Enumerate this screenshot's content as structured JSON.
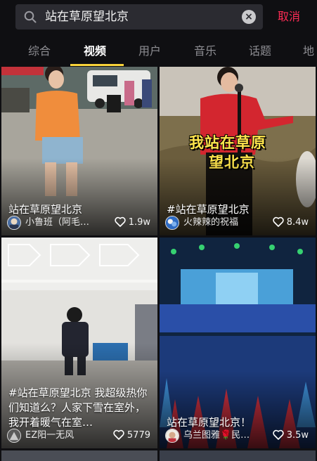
{
  "search": {
    "query": "站在草原望北京",
    "clear_symbol": "×",
    "cancel_label": "取消"
  },
  "tabs": [
    {
      "label": "综合",
      "active": false
    },
    {
      "label": "视频",
      "active": true
    },
    {
      "label": "用户",
      "active": false
    },
    {
      "label": "音乐",
      "active": false
    },
    {
      "label": "话题",
      "active": false
    },
    {
      "label": "地",
      "active": false
    }
  ],
  "colors": {
    "accent": "#fe2c55",
    "tab_indicator": "#f8d33a",
    "background": "#0f0f12"
  },
  "videos": [
    {
      "title": "站在草原望北京",
      "author": "小鲁班（阿毛…",
      "likes": "1.9w"
    },
    {
      "title": "#站在草原望北京",
      "overlay_line1": "我站在草原",
      "overlay_line2": "望北京",
      "author": "火辣辣的祝福",
      "likes": "8.4w"
    },
    {
      "title": "#站在草原望北京 我超级热你们知道么？人家下雪在室外，我开着暖气在室…",
      "author": "EZ阳一无风",
      "likes": "5779"
    },
    {
      "title": "站在草原望北京！",
      "author": "乌兰图雅🌹民…",
      "likes": "3.5w"
    }
  ]
}
